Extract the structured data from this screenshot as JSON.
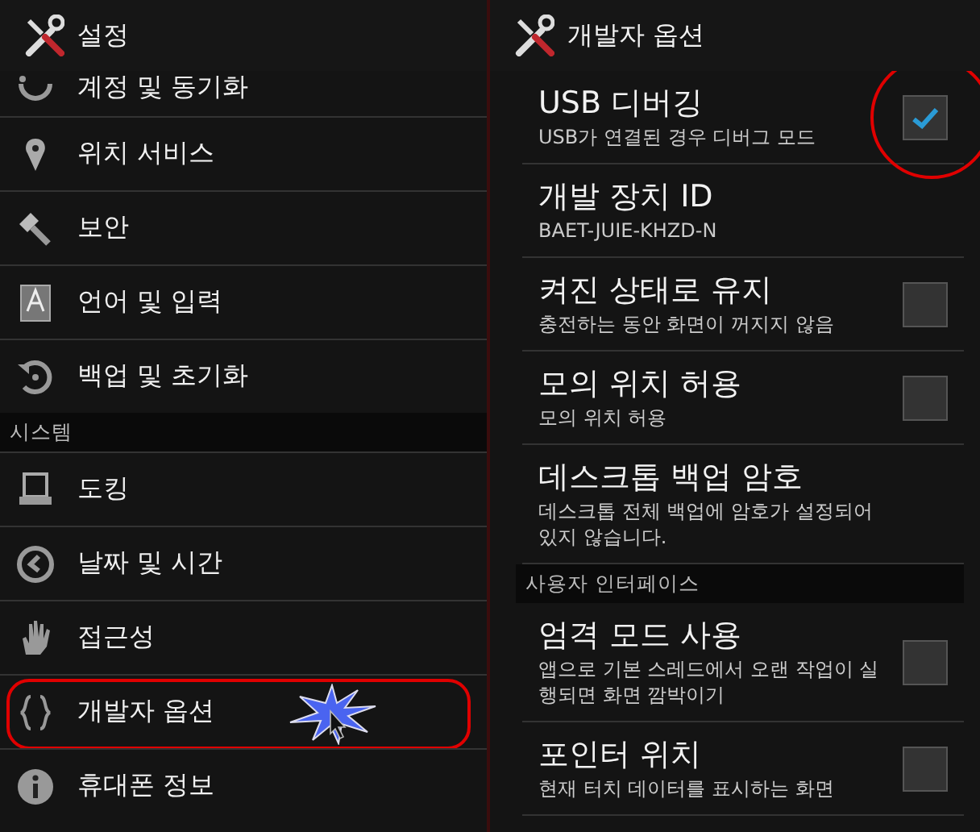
{
  "left_panel": {
    "title": "설정",
    "items": [
      {
        "kind": "item",
        "label": "계정 및 동기화",
        "highlighted": false
      },
      {
        "kind": "item",
        "label": "위치 서비스",
        "highlighted": false
      },
      {
        "kind": "item",
        "label": "보안",
        "highlighted": false
      },
      {
        "kind": "item",
        "label": "언어 및 입력",
        "highlighted": false
      },
      {
        "kind": "item",
        "label": "백업 및 초기화",
        "highlighted": false
      },
      {
        "kind": "section",
        "label": "시스템"
      },
      {
        "kind": "item",
        "label": "도킹",
        "highlighted": false
      },
      {
        "kind": "item",
        "label": "날짜 및 시간",
        "highlighted": false
      },
      {
        "kind": "item",
        "label": "접근성",
        "highlighted": false
      },
      {
        "kind": "item",
        "label": "개발자 옵션",
        "highlighted": true
      },
      {
        "kind": "item",
        "label": "휴대폰 정보",
        "highlighted": false
      }
    ]
  },
  "right_panel": {
    "title": "개발자 옵션",
    "items": [
      {
        "kind": "checkbox",
        "title": "USB 디버깅",
        "summary": "USB가 연결된 경우 디버그 모드",
        "checked": true,
        "highlighted": true
      },
      {
        "kind": "info",
        "title": "개발 장치 ID",
        "summary": "BAET-JUIE-KHZD-N"
      },
      {
        "kind": "checkbox",
        "title": "켜진 상태로 유지",
        "summary": "충전하는 동안 화면이 꺼지지 않음",
        "checked": false,
        "highlighted": false
      },
      {
        "kind": "checkbox",
        "title": "모의 위치 허용",
        "summary": "모의 위치 허용",
        "checked": false,
        "highlighted": false
      },
      {
        "kind": "info",
        "title": "데스크톱 백업 암호",
        "summary": "데스크톱 전체 백업에 암호가 설정되어 있지 않습니다."
      },
      {
        "kind": "section",
        "title": "사용자 인터페이스"
      },
      {
        "kind": "checkbox",
        "title": "엄격 모드 사용",
        "summary": "앱으로 기본 스레드에서 오랜 작업이 실행되면 화면 깜박이기",
        "checked": false,
        "highlighted": false
      },
      {
        "kind": "checkbox",
        "title": "포인터 위치",
        "summary": "현재 터치 데이터를 표시하는 화면",
        "checked": false,
        "highlighted": false
      }
    ]
  }
}
